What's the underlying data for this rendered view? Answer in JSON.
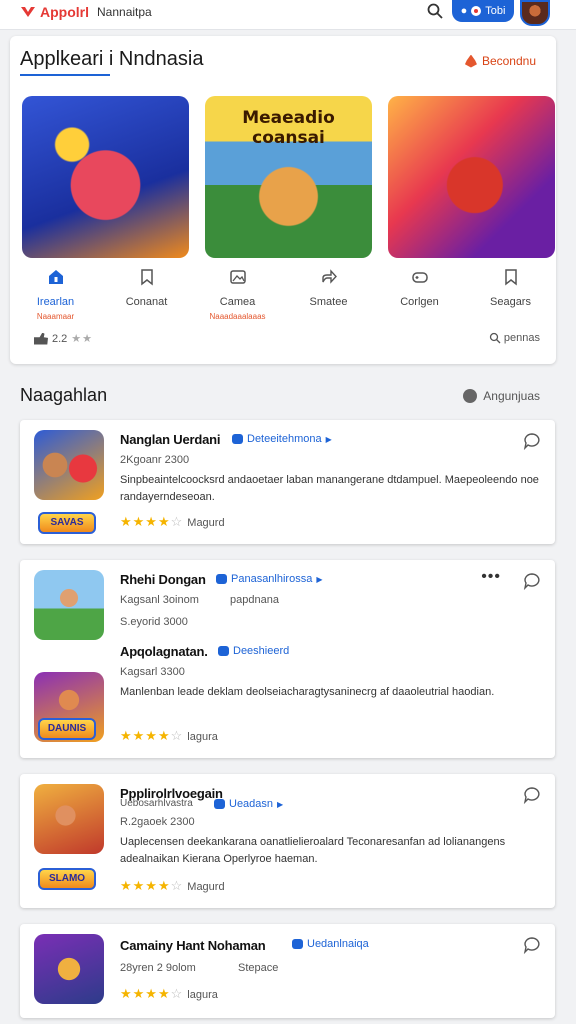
{
  "topbar": {
    "brand": "Appolrl",
    "subtitle": "Nannaitpa",
    "pill_label": "Tobi"
  },
  "featured": {
    "title": "Applkeari i Nndnasia",
    "top_link": "Becondnu",
    "tiles": [
      {
        "title": ""
      },
      {
        "title": "Meaeadio coansai"
      },
      {
        "title": ""
      }
    ],
    "tabs": [
      {
        "label": "Irearlan",
        "sub": "Naaamaar"
      },
      {
        "label": "Conanat",
        "sub": ""
      },
      {
        "label": "Camea",
        "sub": "Naaadaaalaaas"
      },
      {
        "label": "Smatee",
        "sub": ""
      },
      {
        "label": "Corlgen",
        "sub": ""
      },
      {
        "label": "Seagars",
        "sub": ""
      }
    ],
    "rating_text": "2.2",
    "reviews_link": "pennas"
  },
  "section": {
    "title": "Naagahlan",
    "action": "Angunjuas"
  },
  "cards": [
    {
      "name": "Nanglan Uerdani",
      "link": "Deteeitehmona",
      "meta": "2Kgoanr 2300",
      "desc": "Sinpbeaintelcoocksrd andaoetaer laban manangerane dtdampuel. Maepeoleendo noe randayerndeseoan.",
      "badge": "SAVAS",
      "rating": 4,
      "tag": "Magurd"
    },
    {
      "name": "Rhehi Dongan",
      "link": "Panasanlhirossa",
      "meta": "Kagsanl 3oinom",
      "meta2": "papdnana",
      "meta3": "S.eyorid 3000",
      "name2": "Apqolagnatan.",
      "link2": "Deeshieerd",
      "meta4": "Kagsarl 3300",
      "desc": "Manlenban leade deklam deolseiacharagtysaninecrg af daaoleutrial haodian.",
      "badge": "DAUNIS",
      "rating": 4,
      "tag": "lagura"
    },
    {
      "name": "Ppplirolrlvoegain",
      "name_sub": "Uebosarhlvastra",
      "link": "Ueadasn",
      "meta": "R.2gaoek 2300",
      "desc": "Uaplecensen deekankarana oanatlielieroalard Teconaresanfan ad lolianangens adealnaikan Kierana Operlyroe haeman.",
      "badge": "SLAMO",
      "rating": 4,
      "tag": "Magurd"
    },
    {
      "name": "Camainy Hant Nohaman",
      "link": "Uedanlnaiqa",
      "meta": "28yren 2 9olom",
      "meta2": "Stepace",
      "rating": 4,
      "tag": "lagura"
    }
  ]
}
